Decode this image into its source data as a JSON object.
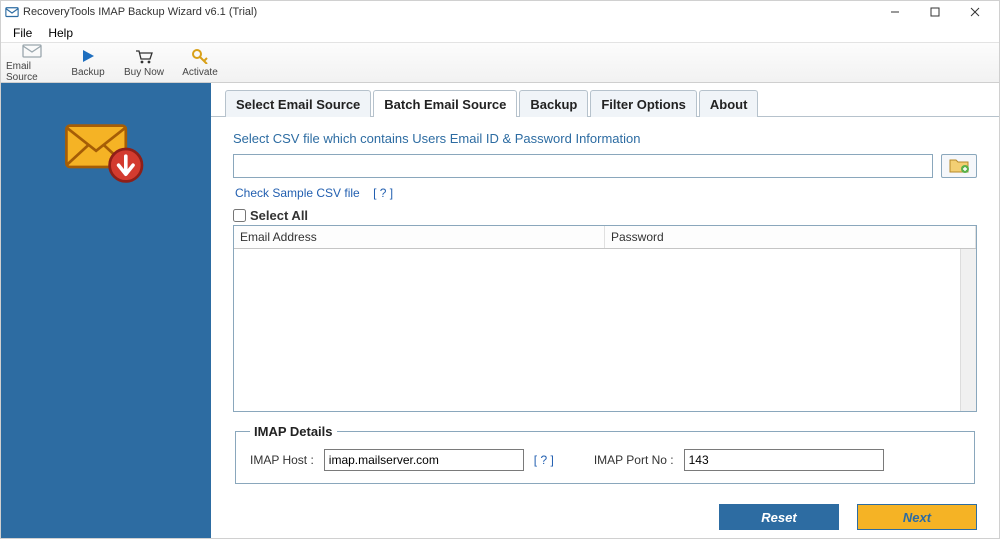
{
  "title": "RecoveryTools IMAP Backup Wizard v6.1 (Trial)",
  "menu": {
    "file": "File",
    "help": "Help"
  },
  "toolbar": {
    "emailSource": "Email Source",
    "backup": "Backup",
    "buyNow": "Buy Now",
    "activate": "Activate"
  },
  "tabs": {
    "selectEmailSource": "Select Email Source",
    "batchEmailSource": "Batch Email Source",
    "backup": "Backup",
    "filterOptions": "Filter Options",
    "about": "About"
  },
  "body": {
    "instruction": "Select CSV file which contains Users Email ID & Password Information",
    "csvPath": "",
    "sampleLink": "Check Sample CSV file",
    "help": "[ ? ]",
    "selectAll": "Select All",
    "columns": {
      "email": "Email Address",
      "password": "Password"
    }
  },
  "imap": {
    "legend": "IMAP Details",
    "hostLabel": "IMAP Host :",
    "hostValue": "imap.mailserver.com",
    "help": "[ ? ]",
    "portLabel": "IMAP Port No :",
    "portValue": "143"
  },
  "actions": {
    "reset": "Reset",
    "next": "Next"
  }
}
